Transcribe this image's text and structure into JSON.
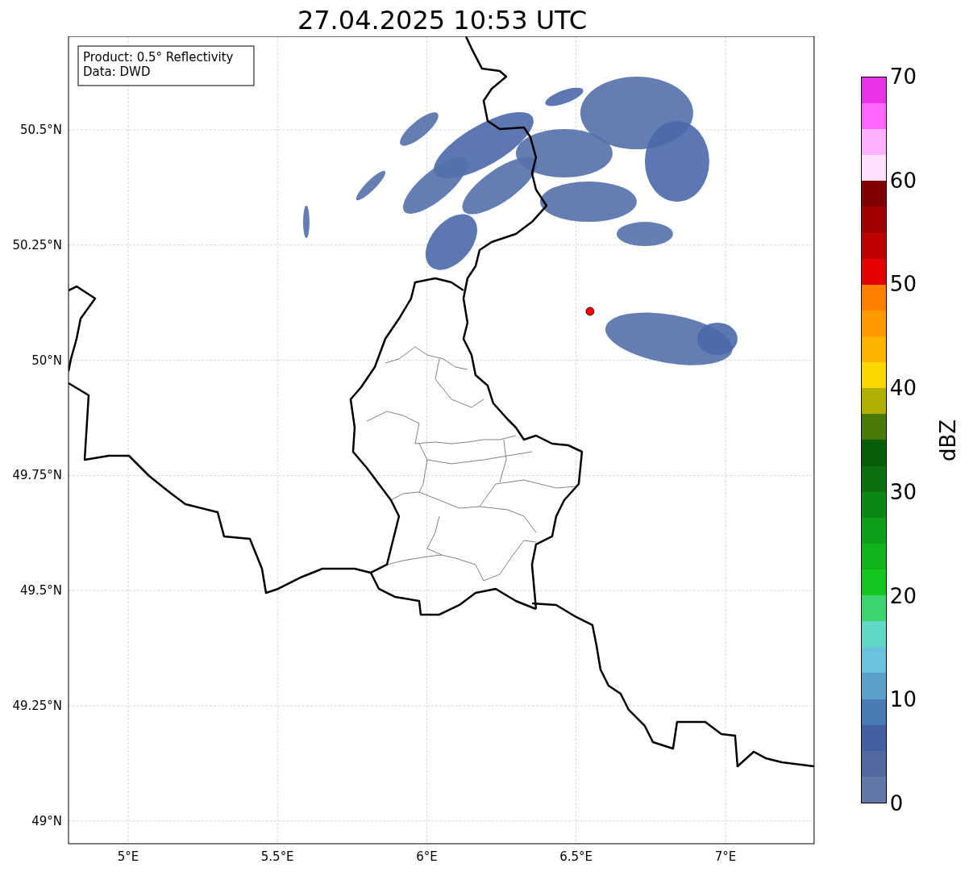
{
  "title": "27.04.2025 10:53 UTC",
  "map": {
    "info_box": [
      "Product: 0.5° Reflectivity",
      "Data: DWD"
    ],
    "lat_labels": [
      "50.5°N",
      "50.25°N",
      "50°N",
      "49.75°N",
      "49.5°N",
      "49.25°N",
      "49°N"
    ],
    "lon_labels": [
      "5°E",
      "5.5°E",
      "6°E",
      "6.5°E",
      "7°E"
    ]
  },
  "colorbar": {
    "label": "dBZ",
    "ticks": [
      "70",
      "60",
      "50",
      "40",
      "30",
      "20",
      "10",
      "0"
    ],
    "segments": [
      {
        "color": "#6478a8"
      },
      {
        "color": "#5468a0"
      },
      {
        "color": "#4460a4"
      },
      {
        "color": "#4a7ab4"
      },
      {
        "color": "#5aa0c8"
      },
      {
        "color": "#6ac2dc"
      },
      {
        "color": "#5fd8c4"
      },
      {
        "color": "#3cd670"
      },
      {
        "color": "#12c81e"
      },
      {
        "color": "#10b41c"
      },
      {
        "color": "#0ea018"
      },
      {
        "color": "#0a8814"
      },
      {
        "color": "#0a7010"
      },
      {
        "color": "#085e08"
      },
      {
        "color": "#4a7a0a"
      },
      {
        "color": "#b0b000"
      },
      {
        "color": "#ffd700"
      },
      {
        "color": "#ffb300"
      },
      {
        "color": "#ff9900"
      },
      {
        "color": "#ff8000"
      },
      {
        "color": "#e60000"
      },
      {
        "color": "#c00000"
      },
      {
        "color": "#a00000"
      },
      {
        "color": "#800000"
      },
      {
        "color": "#ffe0ff"
      },
      {
        "color": "#ffb0ff"
      },
      {
        "color": "#ff66ff"
      },
      {
        "color": "#e833e8"
      }
    ]
  }
}
